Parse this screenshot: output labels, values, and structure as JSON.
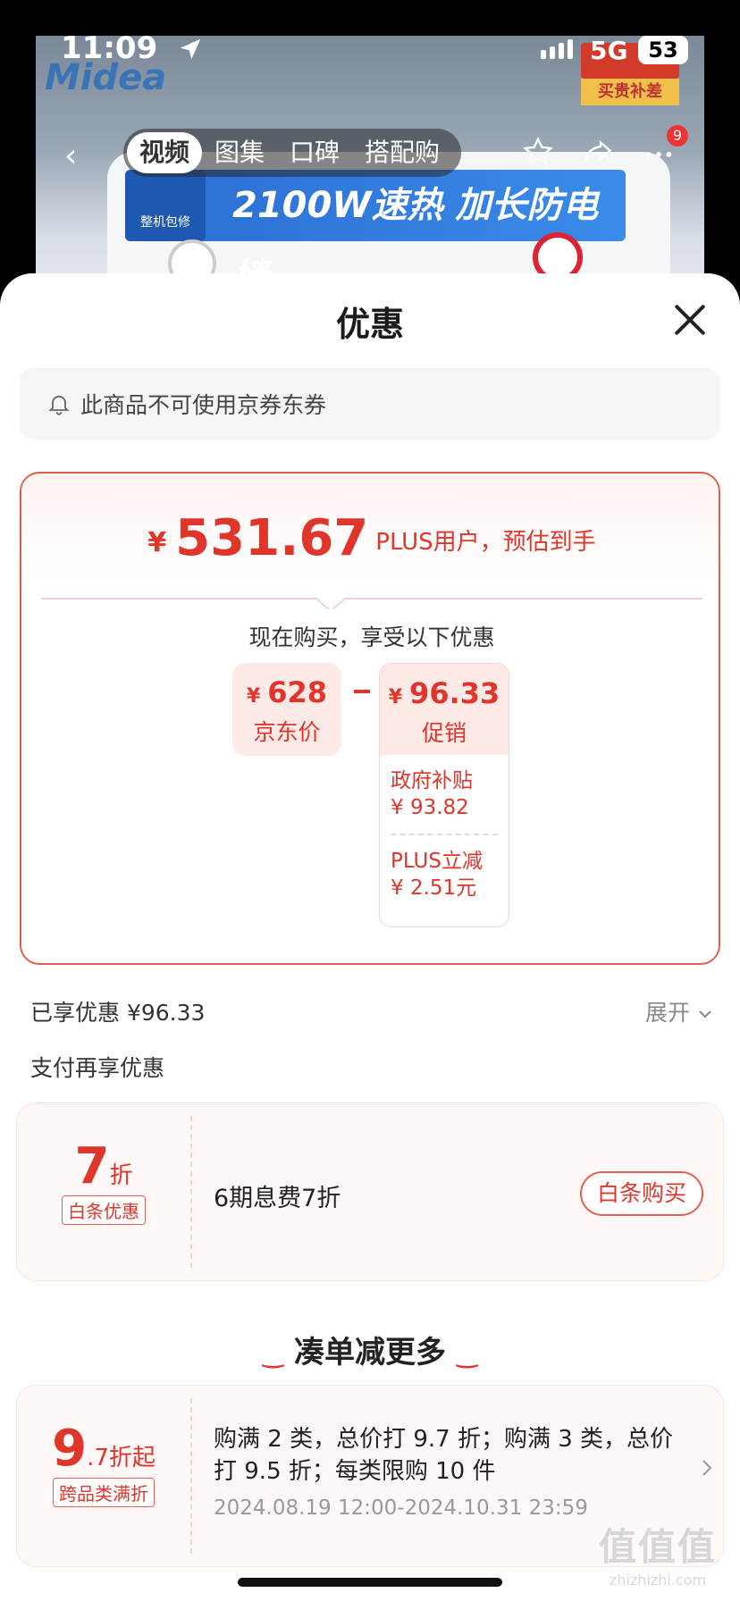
{
  "status_bar": {
    "time": "11:09",
    "network": "5G",
    "battery": "53"
  },
  "banner": {
    "brand": "Midea",
    "corner_tag": "买贵补差",
    "warranty": "整机包修",
    "slogan": "2100W速热 加长防电墙"
  },
  "topnav": {
    "tabs": [
      {
        "label": "视频",
        "active": true
      },
      {
        "label": "图集",
        "active": false
      },
      {
        "label": "口碑",
        "active": false
      },
      {
        "label": "搭配购",
        "active": false
      }
    ],
    "badge": "9"
  },
  "sheet": {
    "title": "优惠",
    "notice": "此商品不可使用京券东券",
    "estimate": {
      "currency": "¥",
      "amount": "531.67",
      "note": "PLUS用户，预估到手"
    },
    "subhead": "现在购买，享受以下优惠",
    "jd_price": {
      "currency": "¥",
      "value": "628",
      "label": "京东价"
    },
    "promo": {
      "currency": "¥",
      "value": "96.33",
      "label": "促销",
      "items": [
        {
          "name": "政府补贴",
          "value": "¥ 93.82"
        },
        {
          "name": "PLUS立减",
          "value": "¥ 2.51元"
        }
      ]
    },
    "enjoyed": "已享优惠 ¥96.33",
    "expand": "展开",
    "pay_title": "支付再享优惠",
    "baitiao": {
      "big": "7",
      "unit": "折",
      "tag": "白条优惠",
      "desc": "6期息费7折",
      "button": "白条购买"
    },
    "more_title": "凑单减更多",
    "cross": {
      "big": "9",
      "unit": ".7折起",
      "tag": "跨品类满折",
      "desc": "购满 2 类，总价打 9.7 折；购满 3 类，总价打 9.5 折；每类限购 10 件",
      "time": "2024.08.19 12:00-2024.10.31 23:59"
    }
  },
  "watermark": {
    "logo": "值值值",
    "url": "zhizhizhi.com"
  },
  "colors": {
    "accent": "#e0352b",
    "pill_bg": "#fde9e6",
    "card_bg": "#fff8f6"
  }
}
